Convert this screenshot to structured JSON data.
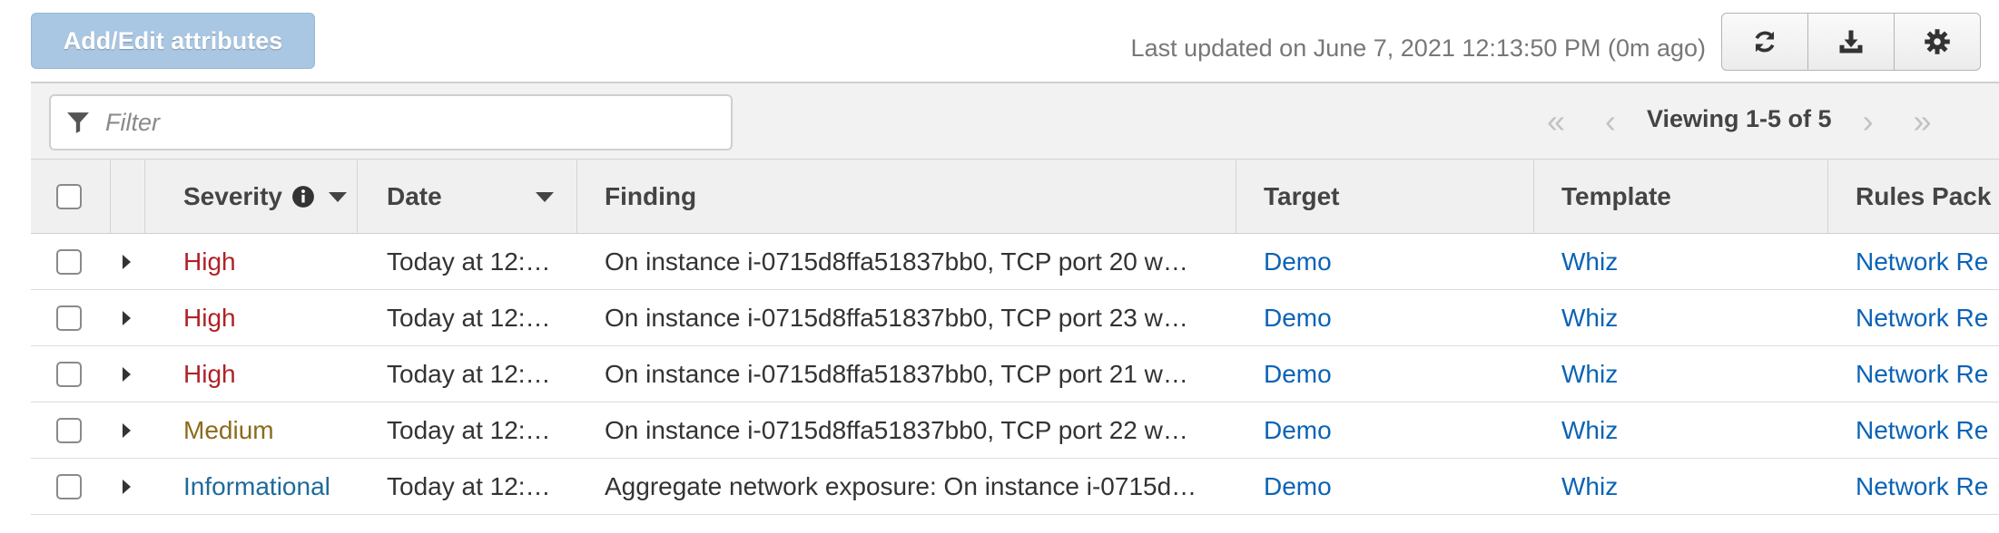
{
  "toolbar": {
    "add_edit_label": "Add/Edit attributes",
    "last_updated": "Last updated on June 7, 2021 12:13:50 PM (0m ago)",
    "icons": [
      "refresh-icon",
      "download-icon",
      "settings-gear-icon"
    ]
  },
  "filter": {
    "placeholder": "Filter",
    "value": ""
  },
  "pagination": {
    "viewing": "Viewing 1-5 of 5",
    "first": "«",
    "prev": "‹",
    "next": "›",
    "last": "»"
  },
  "table": {
    "columns": {
      "severity": "Severity",
      "date": "Date",
      "finding": "Finding",
      "target": "Target",
      "template": "Template",
      "rules_package": "Rules Pack"
    },
    "rows": [
      {
        "severity": "High",
        "severity_level": "high",
        "date": "Today at 12:…",
        "finding": "On instance i-0715d8ffa51837bb0, TCP port 20 w…",
        "target": "Demo",
        "template": "Whiz",
        "rules_package": "Network Re"
      },
      {
        "severity": "High",
        "severity_level": "high",
        "date": "Today at 12:…",
        "finding": "On instance i-0715d8ffa51837bb0, TCP port 23 w…",
        "target": "Demo",
        "template": "Whiz",
        "rules_package": "Network Re"
      },
      {
        "severity": "High",
        "severity_level": "high",
        "date": "Today at 12:…",
        "finding": "On instance i-0715d8ffa51837bb0, TCP port 21 w…",
        "target": "Demo",
        "template": "Whiz",
        "rules_package": "Network Re"
      },
      {
        "severity": "Medium",
        "severity_level": "medium",
        "date": "Today at 12:…",
        "finding": "On instance i-0715d8ffa51837bb0, TCP port 22 w…",
        "target": "Demo",
        "template": "Whiz",
        "rules_package": "Network Re"
      },
      {
        "severity": "Informational",
        "severity_level": "info",
        "date": "Today at 12:…",
        "finding": "Aggregate network exposure: On instance i-0715d…",
        "target": "Demo",
        "template": "Whiz",
        "rules_package": "Network Re"
      }
    ]
  },
  "colors": {
    "severity_high": "#b02127",
    "severity_medium": "#8c6b1c",
    "severity_info": "#1f6a9a",
    "link": "#0b63b5",
    "primary_button_disabled": "#a9c6e2"
  }
}
